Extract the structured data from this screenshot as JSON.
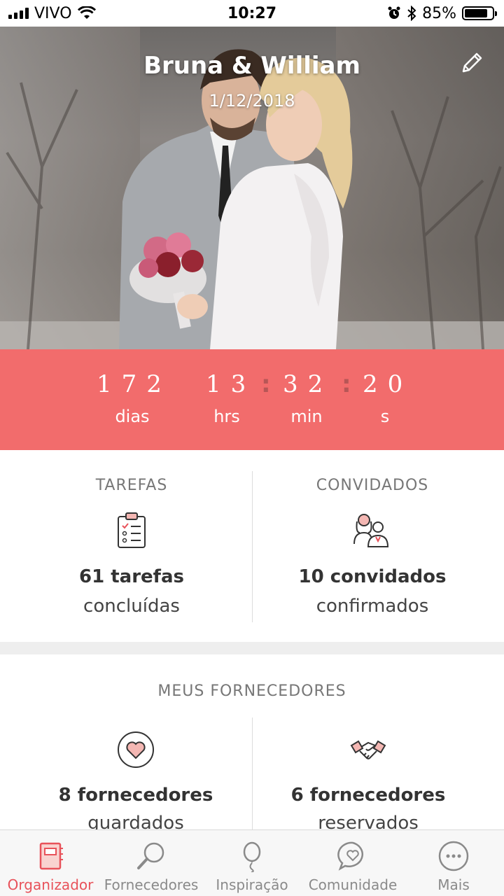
{
  "status_bar": {
    "carrier": "VIVO",
    "time": "10:27",
    "battery": "85%",
    "battery_level": 0.85,
    "icons": [
      "signal-icon",
      "wifi-icon",
      "alarm-icon",
      "bluetooth-icon",
      "battery-icon"
    ]
  },
  "header": {
    "couple_names": "Bruna & William",
    "wedding_date": "1/12/2018",
    "edit_icon": "pencil-icon"
  },
  "countdown": {
    "days": "172",
    "hours": "13",
    "minutes": "32",
    "seconds": "20",
    "days_label": "dias",
    "hours_label": "hrs",
    "minutes_label": "min",
    "seconds_label": "s",
    "bg_color": "#f26c6c"
  },
  "stats": {
    "tasks": {
      "title": "TAREFAS",
      "icon": "clipboard-checklist-icon",
      "count_text": "61 tarefas",
      "sub_text": "concluídas"
    },
    "guests": {
      "title": "CONVIDADOS",
      "icon": "couple-guests-icon",
      "count_text": "10 convidados",
      "sub_text": "confirmados"
    }
  },
  "vendors": {
    "title": "MEUS FORNECEDORES",
    "saved": {
      "icon": "heart-circle-icon",
      "count_text": "8 fornecedores",
      "sub_text": "guardados"
    },
    "booked": {
      "icon": "handshake-icon",
      "count_text": "6 fornecedores",
      "sub_text": "reservados"
    }
  },
  "tabbar": {
    "active_color": "#e8525a",
    "tabs": [
      {
        "label": "Organizador",
        "icon": "notebook-icon",
        "active": true
      },
      {
        "label": "Fornecedores",
        "icon": "magnifier-icon",
        "active": false
      },
      {
        "label": "Inspiração",
        "icon": "balloon-icon",
        "active": false
      },
      {
        "label": "Comunidade",
        "icon": "chat-heart-icon",
        "active": false
      },
      {
        "label": "Mais",
        "icon": "more-dots-icon",
        "active": false
      }
    ]
  }
}
